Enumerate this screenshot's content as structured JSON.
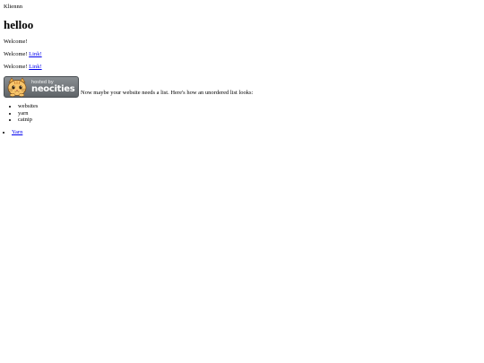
{
  "header": {
    "site_name": "Kliennn"
  },
  "main": {
    "title": "helloo",
    "welcome_1": "Welcome!",
    "welcome_2": "Welcome!",
    "link_2": "Link!",
    "welcome_3": "Welcome!",
    "link_3": "Link!",
    "badge": {
      "small_text": "hosted by",
      "big_text": "neocities"
    },
    "list_intro": "Now maybe your website needs a list. Here's how an unordered list looks:",
    "list_items": [
      "websites",
      "yarn",
      "catnip"
    ],
    "nav_links": [
      "Yarn"
    ]
  },
  "colors": {
    "link": "#0000ee",
    "badge_bg": "#6b7074"
  }
}
